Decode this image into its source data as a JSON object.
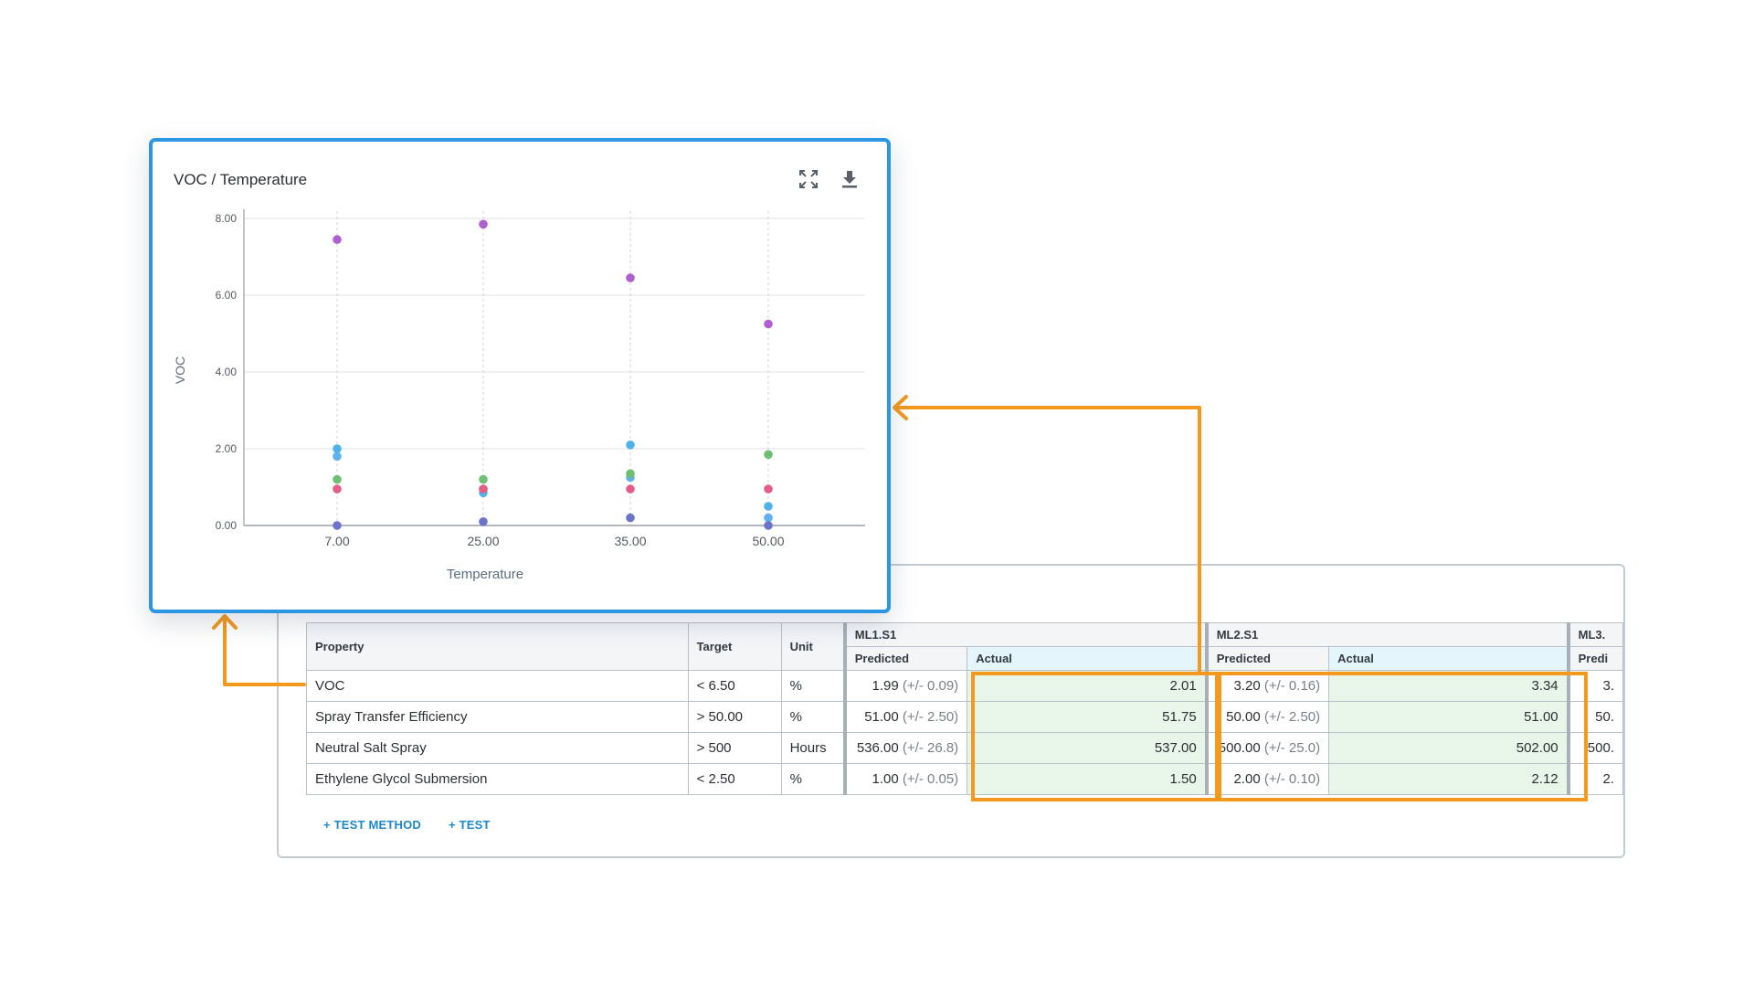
{
  "chart": {
    "title": "VOC / Temperature",
    "xlabel": "Temperature",
    "ylabel": "VOC"
  },
  "chart_data": {
    "type": "scatter",
    "title": "VOC / Temperature",
    "xlabel": "Temperature",
    "ylabel": "VOC",
    "categories": [
      "7.00",
      "25.00",
      "35.00",
      "50.00"
    ],
    "yticks": [
      "0.00",
      "2.00",
      "4.00",
      "6.00",
      "8.00"
    ],
    "ylim": [
      0,
      8
    ],
    "grid": true,
    "legend": "none",
    "series": [
      {
        "color": "#b05fcf",
        "values": [
          7.45,
          7.85,
          6.45,
          5.25
        ]
      },
      {
        "color": "#4fb3ea",
        "values": [
          2.0,
          0.85,
          2.1,
          0.5
        ]
      },
      {
        "color": "#5eb2ef",
        "values": [
          1.8,
          0.95,
          1.25,
          0.2
        ]
      },
      {
        "color": "#6dbf72",
        "values": [
          1.2,
          1.2,
          1.35,
          1.85
        ]
      },
      {
        "color": "#e35d86",
        "values": [
          0.95,
          0.95,
          0.95,
          0.95
        ]
      },
      {
        "color": "#6b74c8",
        "values": [
          0.0,
          0.1,
          0.2,
          0.0
        ]
      }
    ]
  },
  "table": {
    "headers": {
      "property": "Property",
      "target": "Target",
      "unit": "Unit",
      "group1": "ML1.S1",
      "group2": "ML2.S1",
      "group3": "ML3.",
      "predicted": "Predicted",
      "actual": "Actual",
      "predicted_cut": "Predi"
    },
    "rows": [
      {
        "property": "VOC",
        "target": "< 6.50",
        "unit": "%",
        "ml1_pred": "1.99",
        "ml1_err": "(+/- 0.09)",
        "ml1_actual": "2.01",
        "ml2_pred": "3.20",
        "ml2_err": "(+/- 0.16)",
        "ml2_actual": "3.34",
        "ml3_pred": "3."
      },
      {
        "property": "Spray Transfer Efficiency",
        "target": "> 50.00",
        "unit": "%",
        "ml1_pred": "51.00",
        "ml1_err": "(+/- 2.50)",
        "ml1_actual": "51.75",
        "ml2_pred": "50.00",
        "ml2_err": "(+/- 2.50)",
        "ml2_actual": "51.00",
        "ml3_pred": "50."
      },
      {
        "property": "Neutral Salt Spray",
        "target": "> 500",
        "unit": "Hours",
        "ml1_pred": "536.00",
        "ml1_err": "(+/- 26.8)",
        "ml1_actual": "537.00",
        "ml2_pred": "500.00",
        "ml2_err": "(+/- 25.0)",
        "ml2_actual": "502.00",
        "ml3_pred": "500."
      },
      {
        "property": "Ethylene Glycol Submersion",
        "target": "< 2.50",
        "unit": "%",
        "ml1_pred": "1.00",
        "ml1_err": "(+/- 0.05)",
        "ml1_actual": "1.50",
        "ml2_pred": "2.00",
        "ml2_err": "(+/- 0.10)",
        "ml2_actual": "2.12",
        "ml3_pred": "2."
      }
    ],
    "add_test_method": "+ TEST METHOD",
    "add_test": "+ TEST"
  },
  "colors": {
    "chart_border": "#2b97e3",
    "highlight": "#f39a1e",
    "actual_fill": "#e8f5e9",
    "link": "#1e88c9"
  }
}
